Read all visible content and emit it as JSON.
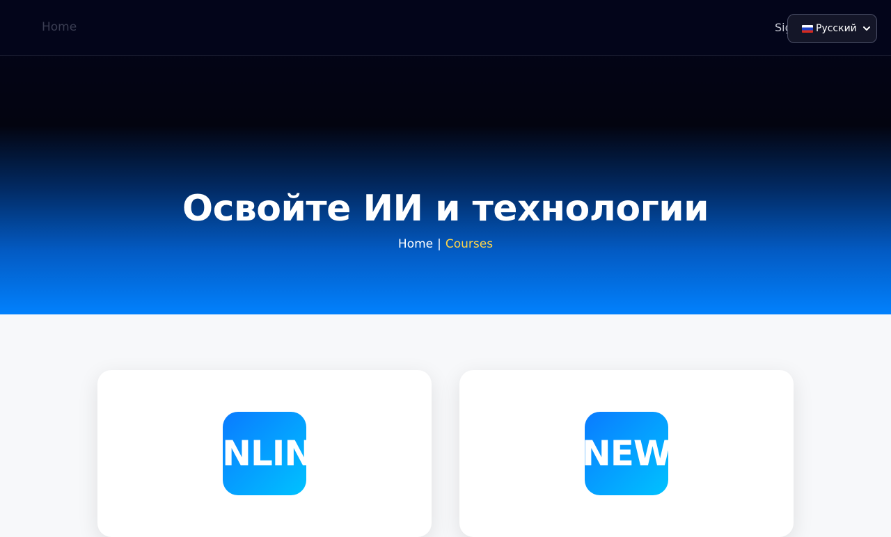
{
  "nav": {
    "home_label": "Home",
    "signin_label": "Sig",
    "language": {
      "selected": "Русский",
      "flag_icon": "russia-flag-icon",
      "chevron_icon": "chevron-down-icon"
    }
  },
  "hero": {
    "title": "Освойте ИИ и технологии",
    "breadcrumb": {
      "home": "Home",
      "separator": "|",
      "current": "Courses"
    }
  },
  "cards": [
    {
      "badge_text": "ONLINE"
    },
    {
      "badge_text": "NEW"
    }
  ],
  "colors": {
    "nav_bg": "#03051a",
    "hero_bottom": "#0281fd",
    "breadcrumb_current": "#ffd54a",
    "badge_gradient_start": "#0a7bff",
    "badge_gradient_end": "#00c2ff"
  }
}
